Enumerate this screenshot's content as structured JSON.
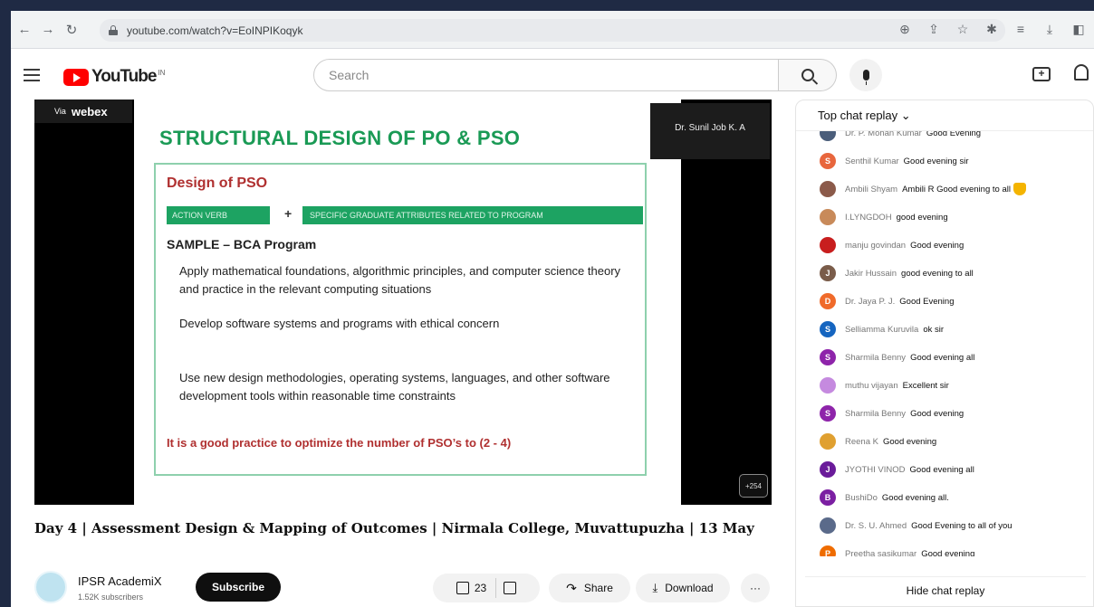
{
  "browser": {
    "url": "youtube.com/watch?v=EoINPIKoqyk"
  },
  "header": {
    "logo_text": "YouTube",
    "region": "IN",
    "search_placeholder": "Search"
  },
  "video": {
    "overlay_via": "Via",
    "overlay_brand": "webex",
    "presenter": "Dr. Sunil Job K. A",
    "participants": "+254",
    "slide": {
      "title": "STRUCTURAL DESIGN OF PO & PSO",
      "heading": "Design of PSO",
      "box_left": "ACTION VERB",
      "plus": "+",
      "box_right": "SPECIFIC GRADUATE ATTRIBUTES RELATED TO PROGRAM",
      "sample": "SAMPLE – BCA Program",
      "bullets": [
        "Apply mathematical foundations, algorithmic principles, and computer science theory and practice in the relevant computing situations",
        "Develop software systems and programs with ethical concern",
        "Use new design methodologies, operating systems, languages, and other software development tools within reasonable time constraints"
      ],
      "note": "It is a good practice to optimize the number of PSO’s to (2 - 4)"
    }
  },
  "info": {
    "title": "Day 4 | Assessment Design & Mapping of Outcomes | Nirmala College, Muvattupuzha | 13 May",
    "channel_name": "IPSR AcademiX",
    "subscribers": "1.52K subscribers",
    "subscribe_label": "Subscribe",
    "likes": "23",
    "share_label": "Share",
    "download_label": "Download",
    "more_label": "···"
  },
  "chat": {
    "header": "Top chat replay",
    "hide_label": "Hide chat replay",
    "messages": [
      {
        "initial": "",
        "color": "#4a5d7a",
        "author": "Dr. P. Mohan Kumar",
        "text": "Good Evening"
      },
      {
        "initial": "S",
        "color": "#e8663d",
        "author": "Senthil Kumar",
        "text": "Good evening sir"
      },
      {
        "initial": "",
        "color": "#8b5a4a",
        "author": "Ambili Shyam",
        "text": "Ambili R Good evening to all"
      },
      {
        "initial": "",
        "color": "#c88a5a",
        "author": "I.LYNGDOH",
        "text": "good evening"
      },
      {
        "initial": "",
        "color": "#c81e1e",
        "author": "manju govindan",
        "text": "Good evening"
      },
      {
        "initial": "J",
        "color": "#7a5c4a",
        "author": "Jakir Hussain",
        "text": "good evening to all"
      },
      {
        "initial": "D",
        "color": "#f06a2a",
        "author": "Dr. Jaya P. J.",
        "text": "Good Evening"
      },
      {
        "initial": "S",
        "color": "#1565c0",
        "author": "Selliamma Kuruvila",
        "text": "ok sir"
      },
      {
        "initial": "S",
        "color": "#8e24aa",
        "author": "Sharmila Benny",
        "text": "Good evening all"
      },
      {
        "initial": "",
        "color": "#c58adf",
        "author": "muthu vijayan",
        "text": "Excellent sir"
      },
      {
        "initial": "S",
        "color": "#8e24aa",
        "author": "Sharmila Benny",
        "text": "Good evening"
      },
      {
        "initial": "",
        "color": "#e0a030",
        "author": "Reena K",
        "text": "Good evening"
      },
      {
        "initial": "J",
        "color": "#6a1b9a",
        "author": "JYOTHI VINOD",
        "text": "Good evening all"
      },
      {
        "initial": "B",
        "color": "#7b1fa2",
        "author": "BushiDo",
        "text": "Good evening all."
      },
      {
        "initial": "",
        "color": "#5a6a8a",
        "author": "Dr. S. U. Ahmed",
        "text": "Good Evening to all of you"
      },
      {
        "initial": "P",
        "color": "#ef6c00",
        "author": "Preetha sasikumar",
        "text": "Good evening"
      }
    ]
  }
}
